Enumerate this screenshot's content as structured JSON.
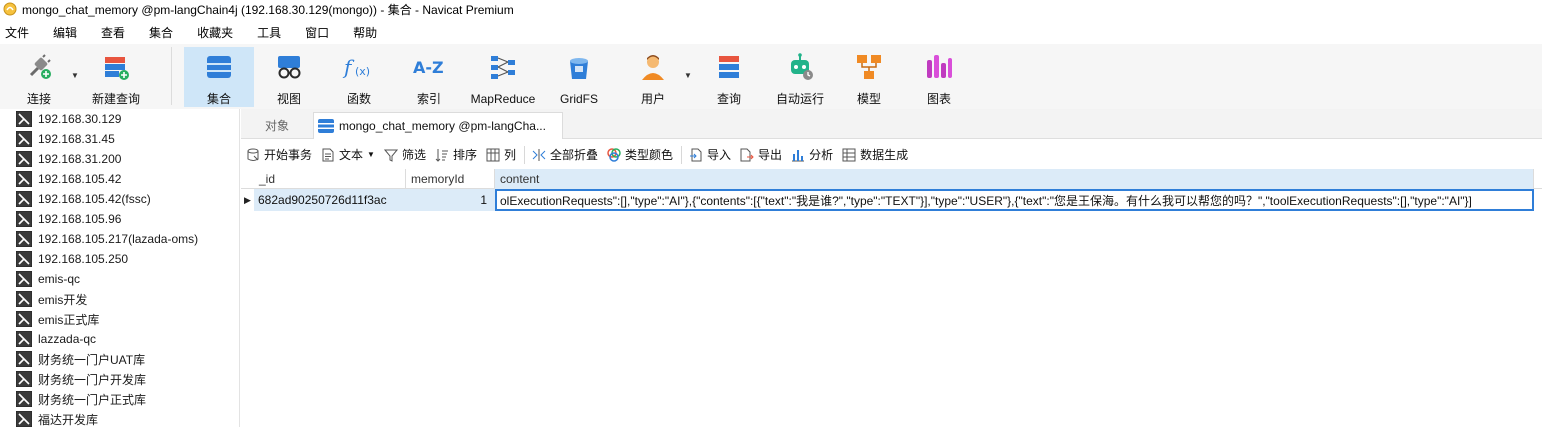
{
  "window": {
    "title": "mongo_chat_memory @pm-langChain4j (192.168.30.129(mongo)) - 集合 - Navicat Premium"
  },
  "menu": [
    "文件",
    "编辑",
    "查看",
    "集合",
    "收藏夹",
    "工具",
    "窗口",
    "帮助"
  ],
  "toolbar": {
    "connect": "连接",
    "new_query": "新建查询",
    "collection": "集合",
    "view": "视图",
    "function": "函数",
    "index": "索引",
    "mapreduce": "MapReduce",
    "gridfs": "GridFS",
    "user": "用户",
    "query": "查询",
    "automation": "自动运行",
    "model": "模型",
    "chart": "图表"
  },
  "sidebar": {
    "items": [
      "192.168.30.129",
      "192.168.31.45",
      "192.168.31.200",
      "192.168.105.42",
      "192.168.105.42(fssc)",
      "192.168.105.96",
      "192.168.105.217(lazada-oms)",
      "192.168.105.250",
      "emis-qc",
      "emis开发",
      "emis正式库",
      "lazzada-qc",
      "财务统一门户UAT库",
      "财务统一门户开发库",
      "财务统一门户正式库",
      "福达开发库"
    ]
  },
  "tabs": {
    "objects": "对象",
    "active": "mongo_chat_memory @pm-langCha..."
  },
  "toolbar2": {
    "begin_tx": "开始事务",
    "text": "文本",
    "filter": "筛选",
    "sort": "排序",
    "columns": "列",
    "collapse_all": "全部折叠",
    "type_color": "类型颜色",
    "import": "导入",
    "export": "导出",
    "analyze": "分析",
    "data_gen": "数据生成"
  },
  "grid": {
    "columns": [
      "_id",
      "memoryId",
      "content"
    ],
    "rows": [
      {
        "id": "682ad90250726d11f3ac",
        "memoryId": "1",
        "content": "olExecutionRequests\":[],\"type\":\"AI\"},{\"contents\":[{\"text\":\"我是谁?\",\"type\":\"TEXT\"}],\"type\":\"USER\"},{\"text\":\"您是王保海。有什么我可以帮您的吗？\",\"toolExecutionRequests\":[],\"type\":\"AI\"}]"
      }
    ]
  },
  "colors": {
    "accent": "#2f7ed8",
    "selected_bg": "#dcebf8",
    "toolbar_bg": "#f6f6f6"
  }
}
